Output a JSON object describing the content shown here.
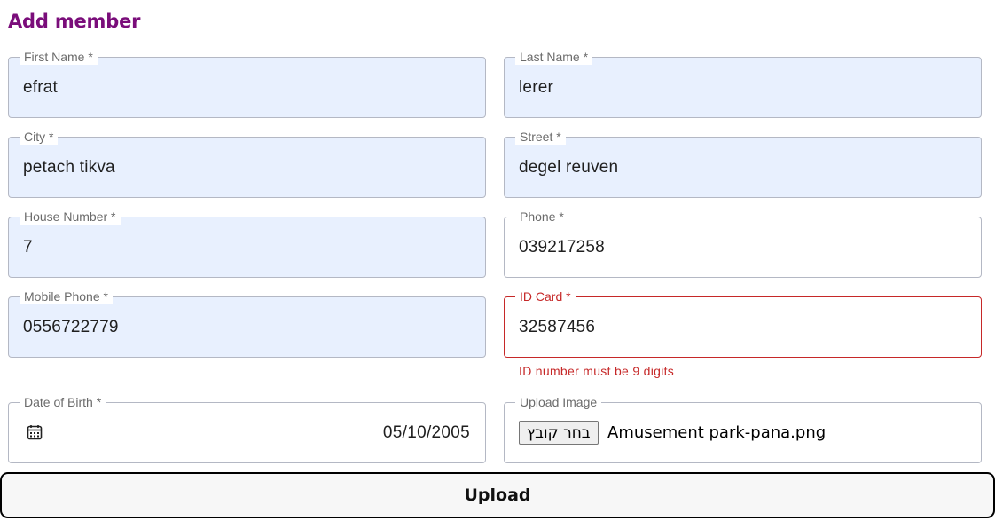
{
  "form": {
    "title": "Add member",
    "fields": {
      "first_name": {
        "label": "First Name *",
        "value": "efrat"
      },
      "last_name": {
        "label": "Last Name *",
        "value": "lerer"
      },
      "city": {
        "label": "City *",
        "value": "petach tikva"
      },
      "street": {
        "label": "Street *",
        "value": "degel reuven"
      },
      "house_number": {
        "label": "House Number *",
        "value": "7"
      },
      "phone": {
        "label": "Phone *",
        "value": "039217258"
      },
      "mobile_phone": {
        "label": "Mobile Phone *",
        "value": "0556722779"
      },
      "id_card": {
        "label": "ID Card *",
        "value": "32587456",
        "error": "ID number must be 9 digits",
        "error_color": "#c62828"
      },
      "date_of_birth": {
        "label": "Date of Birth *",
        "value": "05/10/2005",
        "icon": "calendar-icon"
      },
      "upload_image": {
        "label": "Upload Image",
        "button_label": "בחר קובץ",
        "file_name": "Amusement park-pana.png"
      }
    },
    "submit_label": "Upload",
    "colors": {
      "title": "#7a0d7a",
      "autofill_bg": "#e8f0fe",
      "error": "#c62828"
    }
  }
}
